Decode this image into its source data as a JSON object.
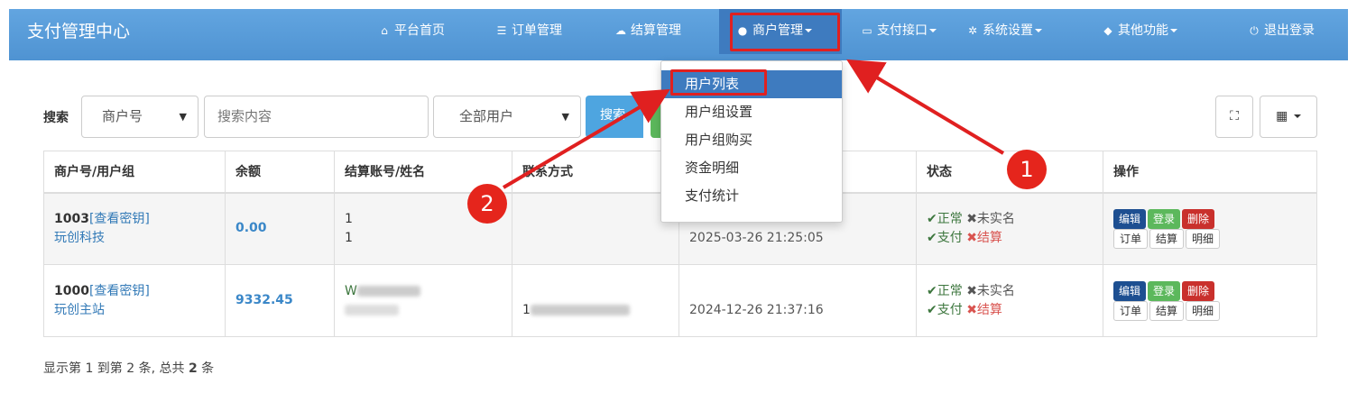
{
  "navbar": {
    "brand": "支付管理中心",
    "items": [
      {
        "icon": "home-icon",
        "glyph": "⌂",
        "label": "平台首页"
      },
      {
        "icon": "list-icon",
        "glyph": "☰",
        "label": "订单管理"
      },
      {
        "icon": "cloud-icon",
        "glyph": "☁",
        "label": "结算管理"
      },
      {
        "icon": "user-icon",
        "glyph": "●",
        "label": "商户管理"
      },
      {
        "icon": "card-icon",
        "glyph": "▭",
        "label": "支付接口"
      },
      {
        "icon": "gear-icon",
        "glyph": "✲",
        "label": "系统设置"
      },
      {
        "icon": "cube-icon",
        "glyph": "◆",
        "label": "其他功能"
      },
      {
        "icon": "power-icon",
        "glyph": "⏻",
        "label": "退出登录"
      }
    ]
  },
  "dropdown": {
    "items": [
      "用户列表",
      "用户组设置",
      "用户组购买",
      "资金明细",
      "支付统计"
    ]
  },
  "search": {
    "label": "搜索",
    "field_select": "商户号",
    "placeholder": "搜索内容",
    "group_select": "全部用户",
    "button": "搜索"
  },
  "table": {
    "headers": [
      "商户号/用户组",
      "余额",
      "结算账号/姓名",
      "联系方式",
      "",
      "状态",
      "操作"
    ],
    "rows": [
      {
        "id": "1003",
        "key_link": "[查看密钥]",
        "group": "玩创科技",
        "balance": "0.00",
        "account": "1",
        "name": "1",
        "time": "2025-03-26 21:25:05",
        "status_normal": "正常",
        "status_realname": "未实名",
        "status_pay": "支付",
        "status_settle": "结算"
      },
      {
        "id": "1000",
        "key_link": "[查看密钥]",
        "group": "玩创主站",
        "balance": "9332.45",
        "account": "W",
        "contact": "1",
        "time": "2024-12-26 21:37:16",
        "status_normal": "正常",
        "status_realname": "未实名",
        "status_pay": "支付",
        "status_settle": "结算"
      }
    ],
    "actions": {
      "edit": "编辑",
      "login": "登录",
      "delete": "删除",
      "orders": "订单",
      "settle": "结算",
      "detail": "明细"
    }
  },
  "pagination": {
    "prefix": "显示第 1 到第 2 条, 总共 ",
    "total": "2",
    "suffix": " 条"
  },
  "annotations": {
    "step1": "1",
    "step2": "2"
  },
  "colors": {
    "navbar": "#4f93d2",
    "highlight": "#e02020",
    "active": "#3e7bbf"
  }
}
